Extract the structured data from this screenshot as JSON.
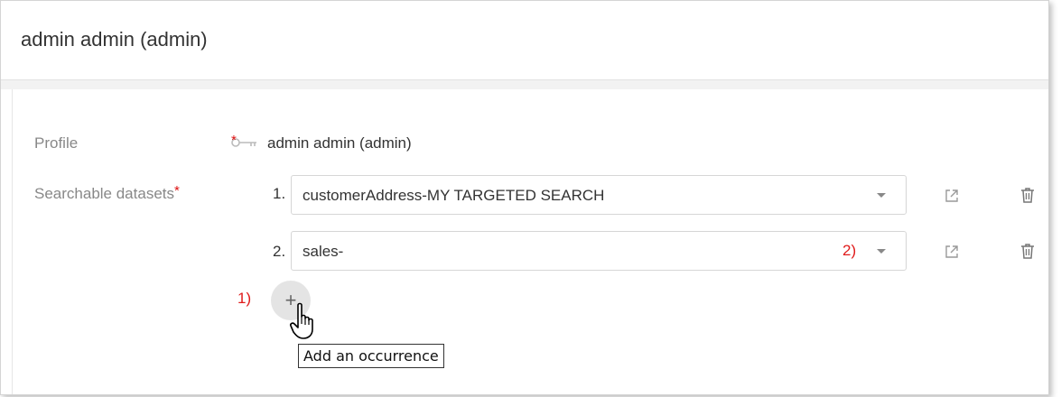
{
  "header": {
    "title": "admin admin (admin)"
  },
  "form": {
    "profile": {
      "label": "Profile",
      "required_mark": "*",
      "value": "admin admin (admin)"
    },
    "datasets": {
      "label": "Searchable datasets",
      "required_mark": "*",
      "items": [
        {
          "index": "1.",
          "value": "customerAddress-MY TARGETED SEARCH"
        },
        {
          "index": "2.",
          "value": "sales-"
        }
      ]
    },
    "add_button": {
      "label": "+",
      "tooltip": "Add an occurrence"
    }
  },
  "annotations": {
    "a1": "1)",
    "a2": "2)"
  },
  "colors": {
    "required": "#d11111",
    "annotation": "#e01b1b",
    "label": "#888888"
  },
  "icons": [
    "key-icon",
    "external-link-icon",
    "trash-icon",
    "caret-down-icon",
    "plus-icon",
    "hand-pointer-cursor"
  ]
}
